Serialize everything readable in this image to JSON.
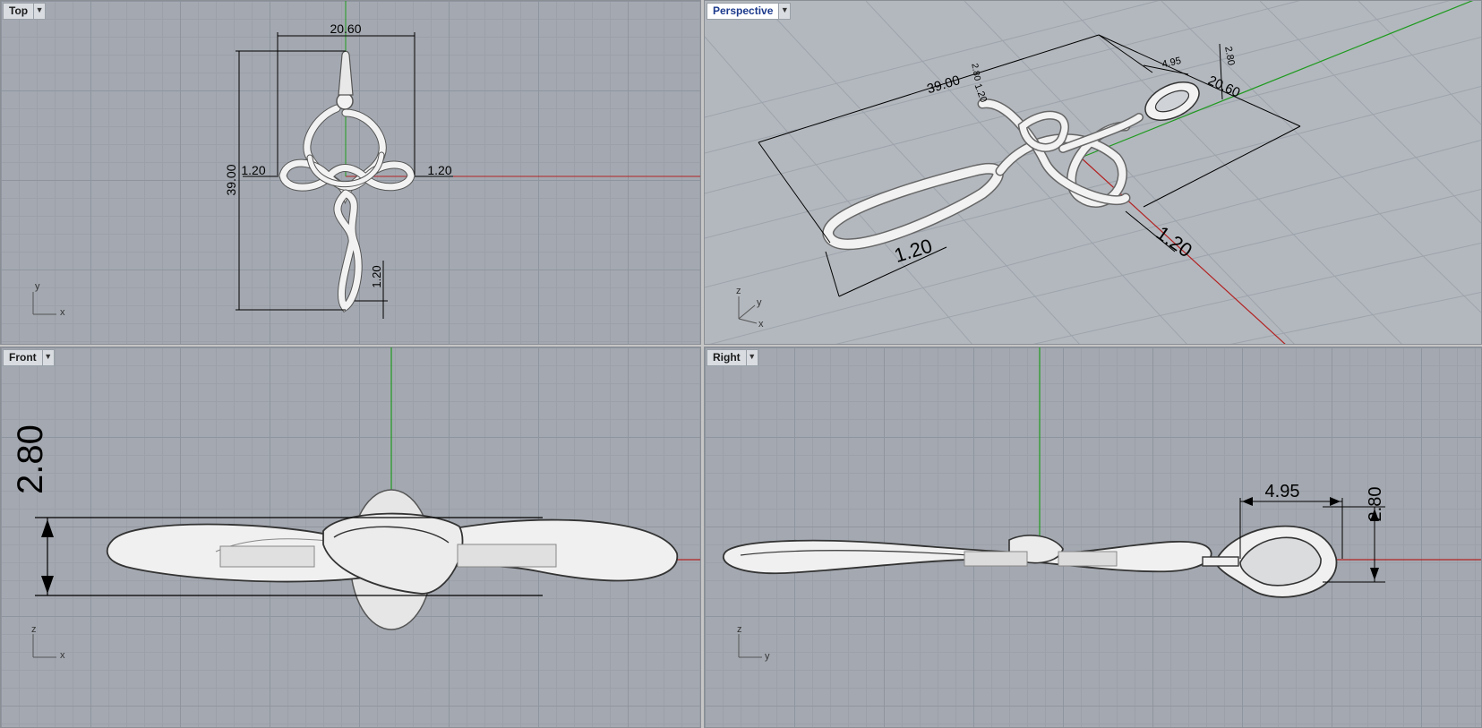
{
  "viewports": {
    "top": {
      "name": "Top",
      "dims": {
        "width": "20.60",
        "height": "39.00",
        "left": "1.20",
        "right": "1.20",
        "bottom": "1.20"
      },
      "axes": {
        "v": "y",
        "h": "x"
      }
    },
    "perspective": {
      "name": "Perspective",
      "dims": {
        "length": "39.00",
        "width": "20.60",
        "bail": "4.95",
        "thick1": "2.80",
        "thick2": "2.80",
        "small": "1.20",
        "bottom_left": "1.20",
        "bottom_right": "1.20"
      },
      "axes": {
        "z": "z",
        "y": "y",
        "x": "x"
      }
    },
    "front": {
      "name": "Front",
      "dims": {
        "height": "2.80"
      },
      "axes": {
        "v": "z",
        "h": "x"
      }
    },
    "right": {
      "name": "Right",
      "dims": {
        "bail_width": "4.95",
        "height": "2.80"
      },
      "axes": {
        "v": "z",
        "h": "y"
      }
    }
  },
  "icons": {
    "dropdown": "chevron-down-icon"
  },
  "colors": {
    "x_axis": "#b22222",
    "y_axis": "#1f9a1f",
    "model": "#f2f2f2",
    "grid_major": "#8f959e"
  }
}
